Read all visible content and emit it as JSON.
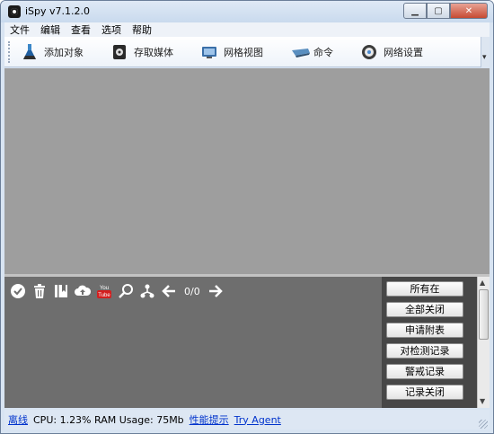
{
  "window": {
    "title": "iSpy v7.1.2.0"
  },
  "menu": [
    "文件",
    "编辑",
    "查看",
    "选项",
    "帮助"
  ],
  "toolbar": {
    "items": [
      {
        "label": "添加对象",
        "icon": "flask-icon"
      },
      {
        "label": "存取媒体",
        "icon": "media-icon"
      },
      {
        "label": "网格视图",
        "icon": "grid-view-icon"
      },
      {
        "label": "命令",
        "icon": "command-icon"
      },
      {
        "label": "网络设置",
        "icon": "network-settings-icon"
      }
    ]
  },
  "bottom": {
    "paging": "0/0",
    "youtube_label": "You Tube",
    "side_buttons": [
      "所有在",
      "全部关闭",
      "申请附表",
      "对检测记录",
      "警戒记录",
      "记录关闭"
    ]
  },
  "status": {
    "offline": "离线",
    "cpu": "CPU: 1.23% RAM Usage: 75Mb",
    "tips": "性能提示",
    "try_agent": "Try Agent"
  },
  "colors": {
    "main_area": "#9e9e9e",
    "bottom_panel": "#6e6e6e",
    "side_panel": "#474747",
    "link": "#0033cc"
  }
}
